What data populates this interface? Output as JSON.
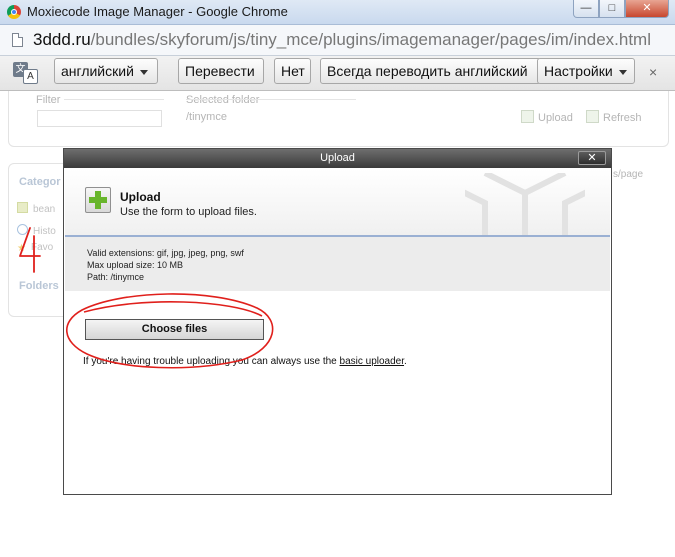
{
  "window": {
    "title": "Moxiecode Image Manager - Google Chrome",
    "controls": {
      "minimize": "—",
      "maximize": "□",
      "close": "✕"
    }
  },
  "address": {
    "host": "3ddd.ru",
    "path": "/bundles/skyforum/js/tiny_mce/plugins/imagemanager/pages/im/index.html"
  },
  "translate_bar": {
    "language": "английский",
    "translate": "Перевести",
    "no": "Нет",
    "always": "Всегда переводить английский",
    "settings": "Настройки",
    "close": "×"
  },
  "background_page": {
    "filter_label": "Filter",
    "selected_folder_label": "Selected folder",
    "selected_folder_value": "/tinymce",
    "upload_tool": "Upload",
    "refresh_tool": "Refresh",
    "categories_title": "Categor",
    "category_items": [
      "bean",
      "Histo",
      "Favo"
    ],
    "folders_title": "Folders",
    "per_page": "s/page"
  },
  "annotation": {
    "digit": "4",
    "color": "#e0201c"
  },
  "dialog": {
    "title": "Upload",
    "close": "✕",
    "heading": "Upload",
    "subheading": "Use the form to upload files.",
    "info_lines": [
      "Valid extensions: gif, jpg, jpeg, png, swf",
      "Max upload size: 10 MB",
      "Path: /tinymce"
    ],
    "choose_button": "Choose files",
    "trouble_text": "If you're having trouble uploading you can always use the ",
    "trouble_link": "basic uploader",
    "trouble_end": "."
  },
  "colors": {
    "accent_line": "#9ab0d3",
    "plus_green": "#68b52c",
    "annotation_red": "#e0201c"
  }
}
